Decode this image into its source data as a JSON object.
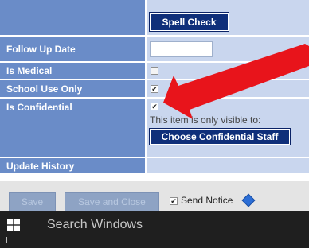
{
  "form": {
    "spell_check_label": "Spell Check",
    "rows": [
      {
        "label": "Follow Up Date"
      },
      {
        "label": "Is Medical",
        "checked": false
      },
      {
        "label": "School Use Only",
        "checked": true
      },
      {
        "label": "Is Confidential",
        "checked": true
      },
      {
        "label": "Update History"
      }
    ],
    "follow_up_value": "",
    "confidential_note": "This item is only visible to:",
    "choose_staff_label": "Choose Confidential Staff"
  },
  "toolbar": {
    "save_label": "Save",
    "save_close_label": "Save and Close",
    "send_notice_label": "Send Notice",
    "send_notice_checked": true
  },
  "taskbar": {
    "search_placeholder": "Search Windows"
  },
  "colors": {
    "label_bg": "#6a8cc8",
    "value_bg": "#c9d6ee",
    "primary_button": "#0f2f7a",
    "arrow": "#e8141b",
    "taskbar": "#1f1f1f"
  },
  "icons": {
    "windows": "windows-logo-icon",
    "info": "info-diamond-icon",
    "annotation": "red-arrow-annotation"
  }
}
